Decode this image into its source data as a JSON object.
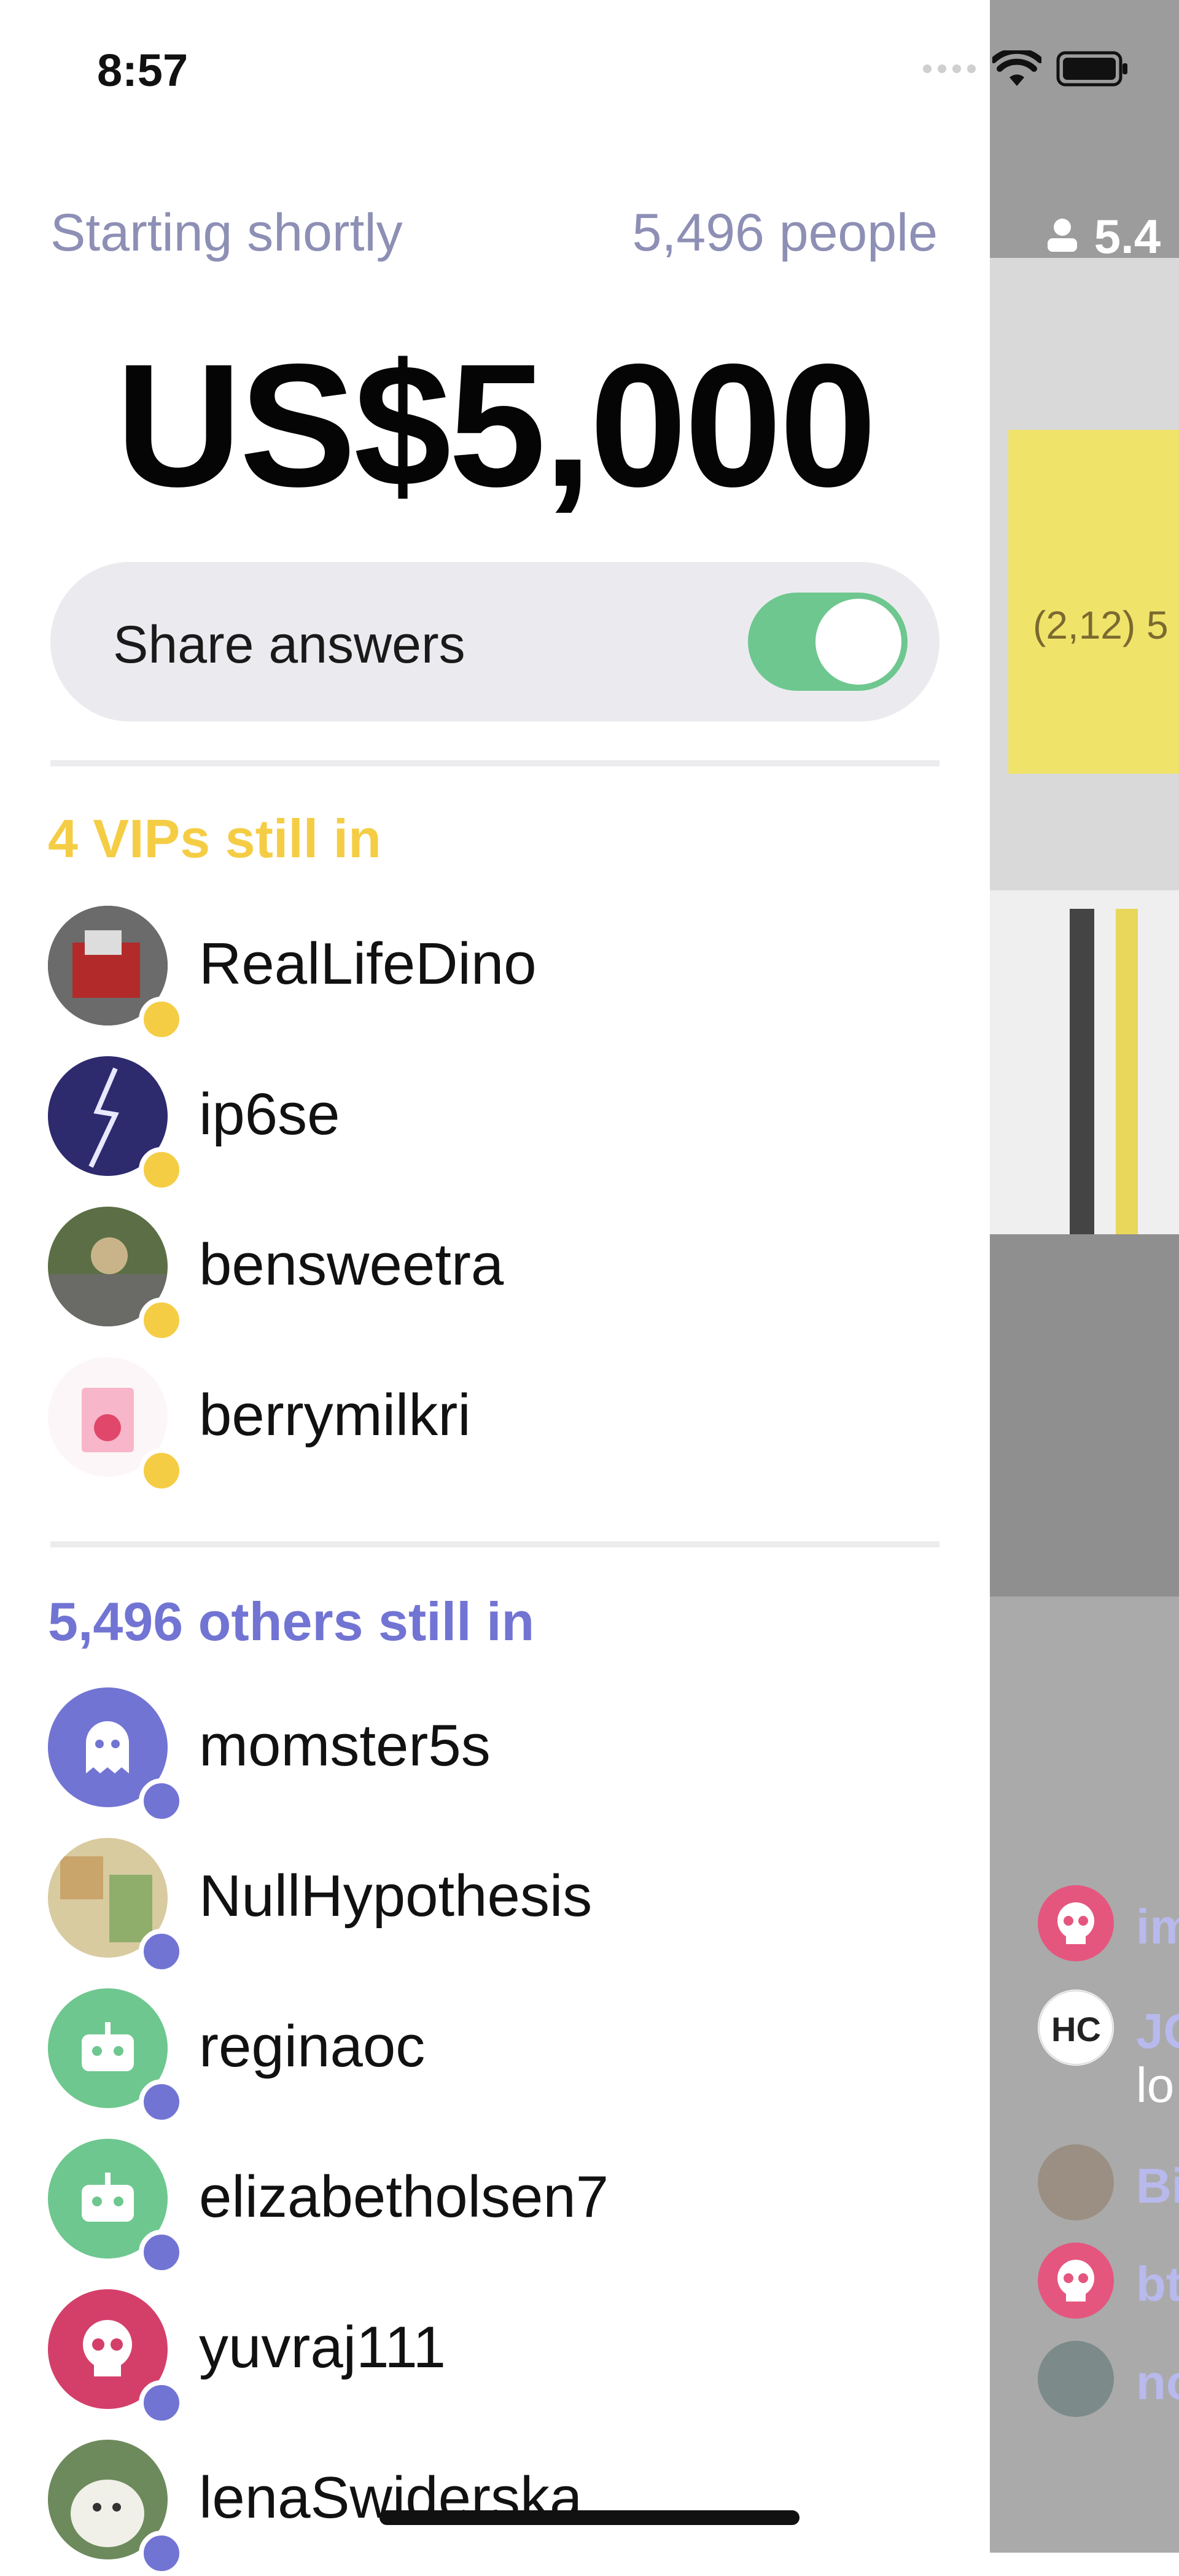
{
  "status_bar": {
    "time": "8:57"
  },
  "panel": {
    "status": "Starting shortly",
    "people": "5,496 people",
    "prize": "US$5,000",
    "share_label": "Share answers",
    "share_on": true,
    "vip_title": "4 VIPs still in",
    "vips": [
      {
        "name": "RealLifeDino"
      },
      {
        "name": "ip6se"
      },
      {
        "name": "bensweetra"
      },
      {
        "name": "berrymilkri"
      }
    ],
    "others_title": "5,496 others still in",
    "others": [
      {
        "name": "momster5s"
      },
      {
        "name": "NullHypothesis"
      },
      {
        "name": "reginaoc"
      },
      {
        "name": "elizabetholsen7"
      },
      {
        "name": "yuvraj111"
      },
      {
        "name": "lenaSwiderska"
      }
    ]
  },
  "video": {
    "viewer_count": "5.4",
    "chat": [
      {
        "name": "im",
        "msg": ""
      },
      {
        "name": "JC",
        "msg": "lo"
      },
      {
        "name": "Bi",
        "msg": ""
      },
      {
        "name": "bt",
        "msg": ""
      },
      {
        "name": "no",
        "msg": ""
      }
    ]
  },
  "colors": {
    "vip": "#f5cd45",
    "others": "#7274d3",
    "muted": "#8d8fb5",
    "toggle": "#6ec78f"
  }
}
